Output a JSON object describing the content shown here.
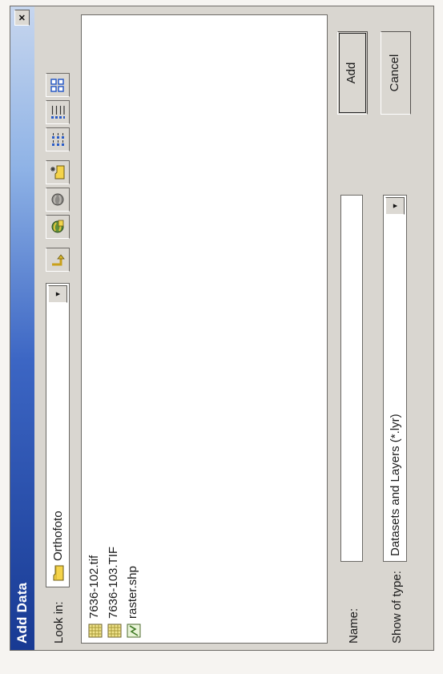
{
  "window": {
    "title": "Add Data",
    "close_label": "×"
  },
  "toolbar": {
    "look_in_label": "Look in:",
    "look_in_value": "Orthofoto",
    "buttons": [
      {
        "icon": "up-one-level-icon"
      },
      {
        "icon": "connect-to-folder-icon"
      },
      {
        "icon": "disconnect-folder-icon"
      },
      {
        "icon": "new-item-icon"
      },
      {
        "icon": "list-view-icon"
      },
      {
        "icon": "details-view-icon"
      },
      {
        "icon": "thumbnails-view-icon"
      }
    ]
  },
  "files": [
    {
      "name": "7636-102.tif",
      "icon": "raster-icon"
    },
    {
      "name": "7636-103.TIF",
      "icon": "raster-icon"
    },
    {
      "name": "raster.shp",
      "icon": "shapefile-icon"
    }
  ],
  "form": {
    "name_label": "Name:",
    "name_value": "",
    "type_label": "Show of type:",
    "type_value": "Datasets and Layers (*.lyr)"
  },
  "actions": {
    "add_label": "Add",
    "cancel_label": "Cancel"
  },
  "colors": {
    "title_gradient_start": "#183a93",
    "title_gradient_end": "#c7d6ee",
    "dialog_face": "#d9d6d0"
  }
}
